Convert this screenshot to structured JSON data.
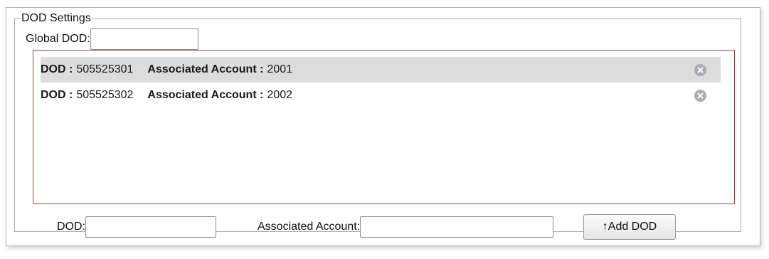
{
  "section": {
    "legend": "DOD Settings"
  },
  "global_dod": {
    "label": "Global DOD:",
    "value": ""
  },
  "dod_list": [
    {
      "dod_label": "DOD :",
      "dod": "505525301",
      "account_label": "Associated Account :",
      "account": "2001",
      "selected": true
    },
    {
      "dod_label": "DOD :",
      "dod": "505525302",
      "account_label": "Associated Account :",
      "account": "2002",
      "selected": false
    }
  ],
  "add_form": {
    "dod_label": "DOD:",
    "dod_value": "",
    "account_label": "Associated Account:",
    "account_value": "",
    "add_button": "↑Add DOD"
  },
  "colors": {
    "selected_row": "#dcdcdc",
    "list_border": "#8a4a2e",
    "remove_icon": "#a9aab4"
  }
}
